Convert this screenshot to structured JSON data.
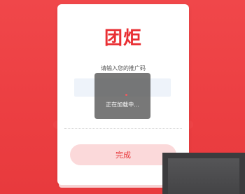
{
  "logo": {
    "text": "团炬"
  },
  "form": {
    "prompt": "请输入您的推广码",
    "code_value": "",
    "code_placeholder": ""
  },
  "loading": {
    "text": "正在加载中..."
  },
  "actions": {
    "done_label": "完成"
  },
  "colors": {
    "background": "#ee4346",
    "brand": "#e92f33",
    "button_bg": "#fbd9da",
    "input_bg": "#eef3fa",
    "overlay": "#5a5a5a"
  }
}
